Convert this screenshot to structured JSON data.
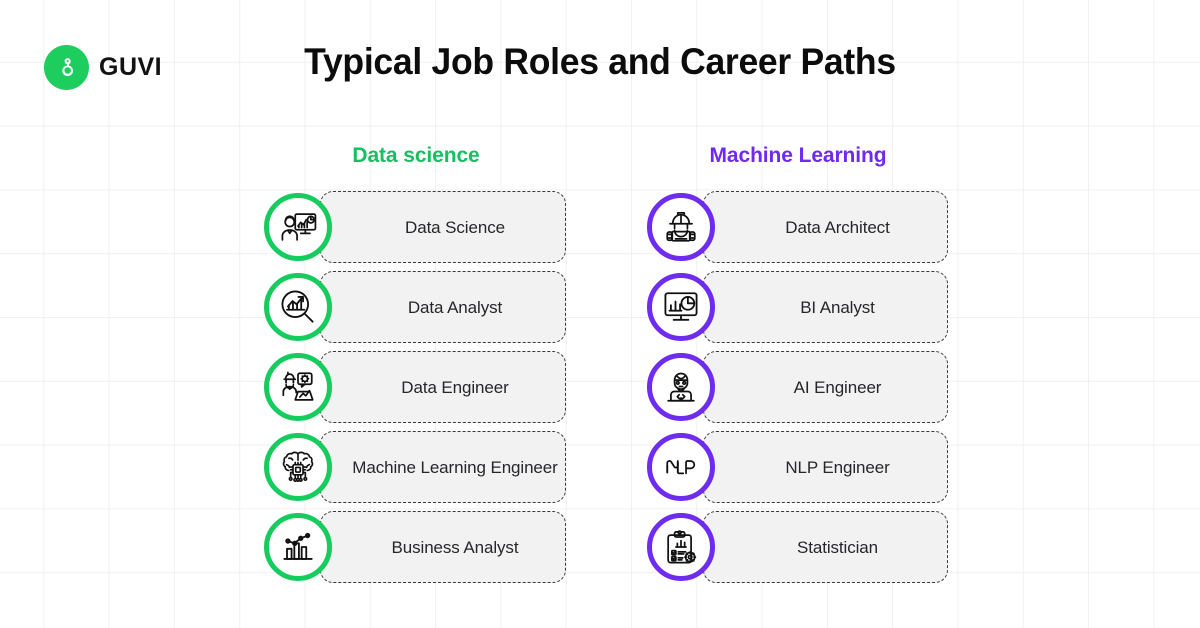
{
  "brand": {
    "name": "GUVI",
    "logo_icon": "guvi-g-logo",
    "logo_color": "#1DCD5E"
  },
  "header": {
    "title": "Typical Job Roles and Career Paths"
  },
  "columns": [
    {
      "key": "data_science",
      "heading": "Data science",
      "accent_color": "#16C060",
      "items": [
        {
          "label": "Data Science",
          "icon": "analyst-at-monitor-icon"
        },
        {
          "label": "Data Analyst",
          "icon": "magnifier-bar-chart-icon"
        },
        {
          "label": "Data Engineer",
          "icon": "engineer-laptop-gear-icon"
        },
        {
          "label": "Machine Learning Engineer",
          "icon": "brain-chip-icon"
        },
        {
          "label": "Business Analyst",
          "icon": "bar-chart-trendline-icon"
        }
      ]
    },
    {
      "key": "machine_learning",
      "heading": "Machine Learning",
      "accent_color": "#7029F0",
      "items": [
        {
          "label": "Data Architect",
          "icon": "hardhat-worker-blueprint-icon"
        },
        {
          "label": "BI Analyst",
          "icon": "monitor-chart-pie-icon"
        },
        {
          "label": "AI Engineer",
          "icon": "developer-code-laptop-icon"
        },
        {
          "label": "NLP Engineer",
          "icon": "nlp-text-icon"
        },
        {
          "label": "Statistician",
          "icon": "clipboard-gear-chart-icon"
        }
      ]
    }
  ],
  "background": {
    "grid_color": "#f0f0f0",
    "page_color": "#ffffff",
    "card_fill": "#F2F2F2",
    "card_border": "#3a3a3a"
  }
}
